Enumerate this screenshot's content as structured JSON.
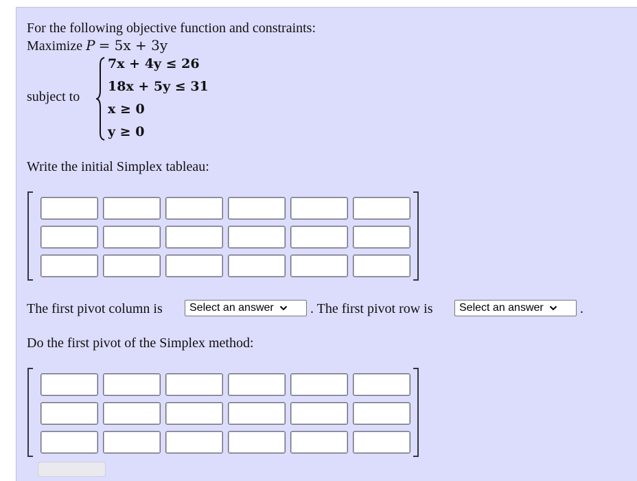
{
  "intro": "For the following objective function and constraints:",
  "objective": {
    "label": "Maximize",
    "variable": "P",
    "expression": "= 5x + 3y"
  },
  "subject_to_label": "subject to",
  "constraints": [
    "7x + 4y ≤ 26",
    "18x + 5y ≤ 31",
    "x ≥ 0",
    "y ≥ 0"
  ],
  "initial_tableau": {
    "prompt": "Write the initial Simplex tableau:",
    "rows": 3,
    "cols": 6,
    "values": [
      [
        "",
        "",
        "",
        "",
        "",
        ""
      ],
      [
        "",
        "",
        "",
        "",
        "",
        ""
      ],
      [
        "",
        "",
        "",
        "",
        "",
        ""
      ]
    ]
  },
  "pivot_question": {
    "column_text": "The first pivot column is",
    "column_select": "Select an answer",
    "row_text": ". The first pivot row is",
    "row_select": "Select an answer",
    "end_text": "."
  },
  "first_pivot": {
    "prompt": "Do the first pivot of the Simplex method:",
    "rows": 3,
    "cols": 6,
    "values": [
      [
        "",
        "",
        "",
        "",
        "",
        ""
      ],
      [
        "",
        "",
        "",
        "",
        "",
        ""
      ],
      [
        "",
        "",
        "",
        "",
        "",
        ""
      ]
    ]
  }
}
